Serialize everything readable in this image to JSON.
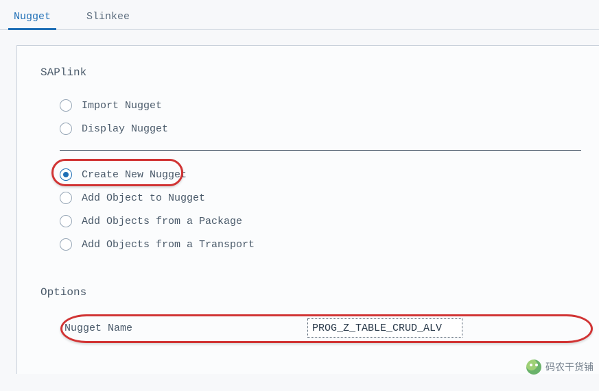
{
  "tabs": {
    "nugget": "Nugget",
    "slinkee": "Slinkee"
  },
  "saplink": {
    "title": "SAPlink",
    "import_nugget": "Import Nugget",
    "display_nugget": "Display Nugget",
    "create_new_nugget": "Create New Nugget",
    "add_object_to_nugget": "Add Object to Nugget",
    "add_objects_from_package": "Add Objects from a Package",
    "add_objects_from_transport": "Add Objects from a Transport"
  },
  "options": {
    "title": "Options",
    "nugget_name_label": "Nugget Name",
    "nugget_name_value": "PROG_Z_TABLE_CRUD_ALV"
  },
  "watermark": {
    "text": "码农干货铺"
  }
}
